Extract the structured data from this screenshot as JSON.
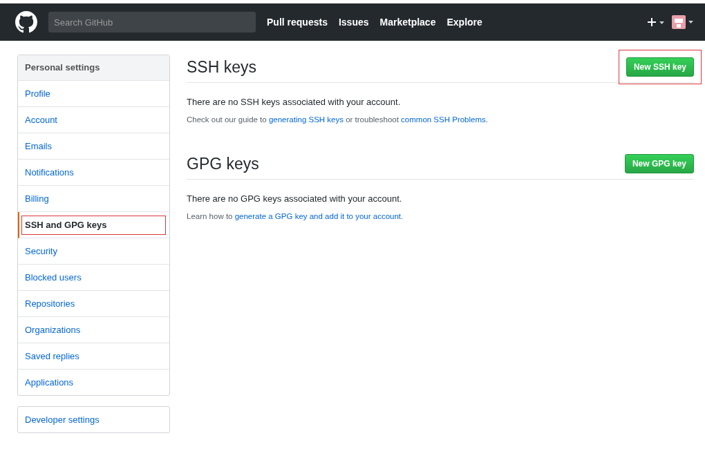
{
  "header": {
    "search": {
      "placeholder": "Search GitHub"
    },
    "nav": [
      "Pull requests",
      "Issues",
      "Marketplace",
      "Explore"
    ]
  },
  "sidebar": {
    "title": "Personal settings",
    "items": [
      {
        "label": "Profile",
        "selected": false,
        "annotated": false
      },
      {
        "label": "Account",
        "selected": false,
        "annotated": false
      },
      {
        "label": "Emails",
        "selected": false,
        "annotated": false
      },
      {
        "label": "Notifications",
        "selected": false,
        "annotated": false
      },
      {
        "label": "Billing",
        "selected": false,
        "annotated": false
      },
      {
        "label": "SSH and GPG keys",
        "selected": true,
        "annotated": true
      },
      {
        "label": "Security",
        "selected": false,
        "annotated": false
      },
      {
        "label": "Blocked users",
        "selected": false,
        "annotated": false
      },
      {
        "label": "Repositories",
        "selected": false,
        "annotated": false
      },
      {
        "label": "Organizations",
        "selected": false,
        "annotated": false
      },
      {
        "label": "Saved replies",
        "selected": false,
        "annotated": false
      },
      {
        "label": "Applications",
        "selected": false,
        "annotated": false
      }
    ],
    "developer": "Developer settings"
  },
  "sections": [
    {
      "title": "SSH keys",
      "button": "New SSH key",
      "annotated": true,
      "empty": "There are no SSH keys associated with your account.",
      "hint": [
        {
          "kind": "text",
          "text": "Check out our guide to "
        },
        {
          "kind": "link",
          "text": "generating SSH keys"
        },
        {
          "kind": "text",
          "text": " or troubleshoot "
        },
        {
          "kind": "link",
          "text": "common SSH Problems"
        },
        {
          "kind": "text",
          "text": "."
        }
      ]
    },
    {
      "title": "GPG keys",
      "button": "New GPG key",
      "annotated": false,
      "empty": "There are no GPG keys associated with your account.",
      "hint": [
        {
          "kind": "text",
          "text": "Learn how to "
        },
        {
          "kind": "link",
          "text": "generate a GPG key and add it to your account"
        },
        {
          "kind": "text",
          "text": "."
        }
      ]
    }
  ]
}
